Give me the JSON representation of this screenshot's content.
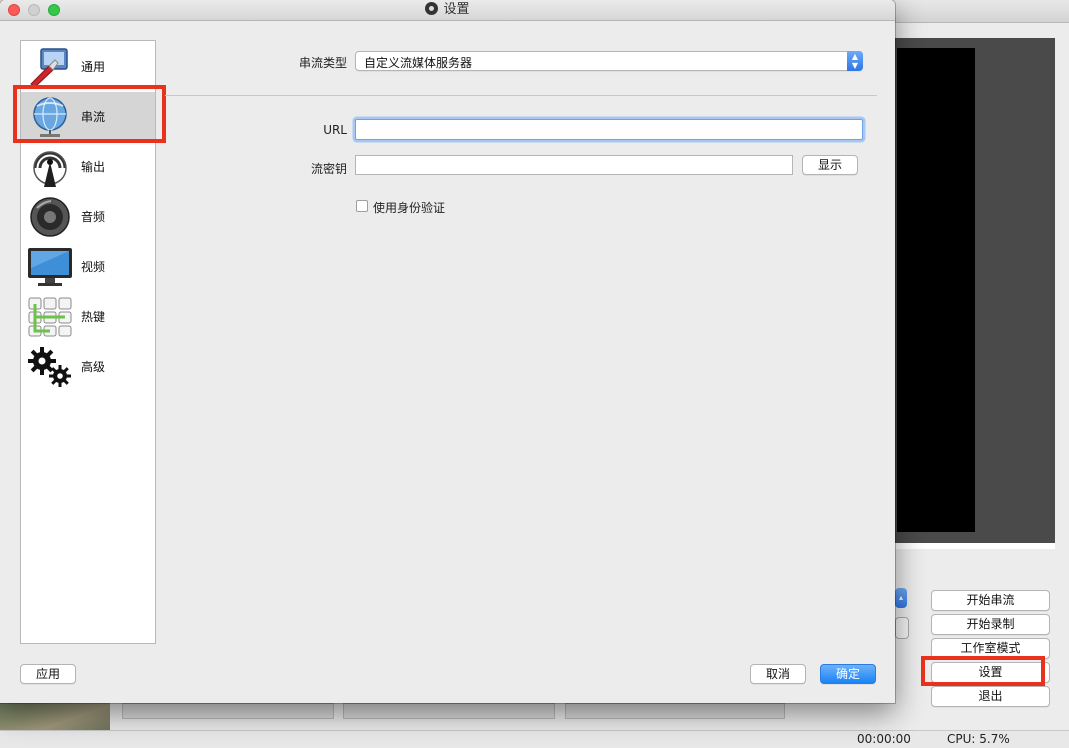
{
  "dialog": {
    "title": "设置"
  },
  "sidebar": {
    "items": [
      {
        "label": "通用",
        "icon": "general-settings-icon"
      },
      {
        "label": "串流",
        "icon": "stream-globe-icon"
      },
      {
        "label": "输出",
        "icon": "output-broadcast-icon"
      },
      {
        "label": "音频",
        "icon": "speaker-icon"
      },
      {
        "label": "视频",
        "icon": "monitor-icon"
      },
      {
        "label": "热键",
        "icon": "keyboard-icon"
      },
      {
        "label": "高级",
        "icon": "gears-icon"
      }
    ],
    "selected_index": 1
  },
  "stream": {
    "type_label": "串流类型",
    "type_value": "自定义流媒体服务器",
    "url_label": "URL",
    "url_value": "",
    "key_label": "流密钥",
    "key_value": "",
    "show_button": "显示",
    "auth_checkbox_label": "使用身份验证",
    "auth_checked": false
  },
  "footer": {
    "apply": "应用",
    "cancel": "取消",
    "ok": "确定"
  },
  "main_window": {
    "buttons": {
      "start_stream": "开始串流",
      "start_record": "开始录制",
      "studio_mode": "工作室模式",
      "settings": "设置",
      "exit": "退出"
    },
    "status": {
      "time": "00:00:00",
      "cpu": "CPU: 5.7%"
    }
  },
  "colors": {
    "highlight_red": "#e8321e",
    "accent_blue": "#1a82f5",
    "selected_item_bg": "#d5d5d5"
  }
}
